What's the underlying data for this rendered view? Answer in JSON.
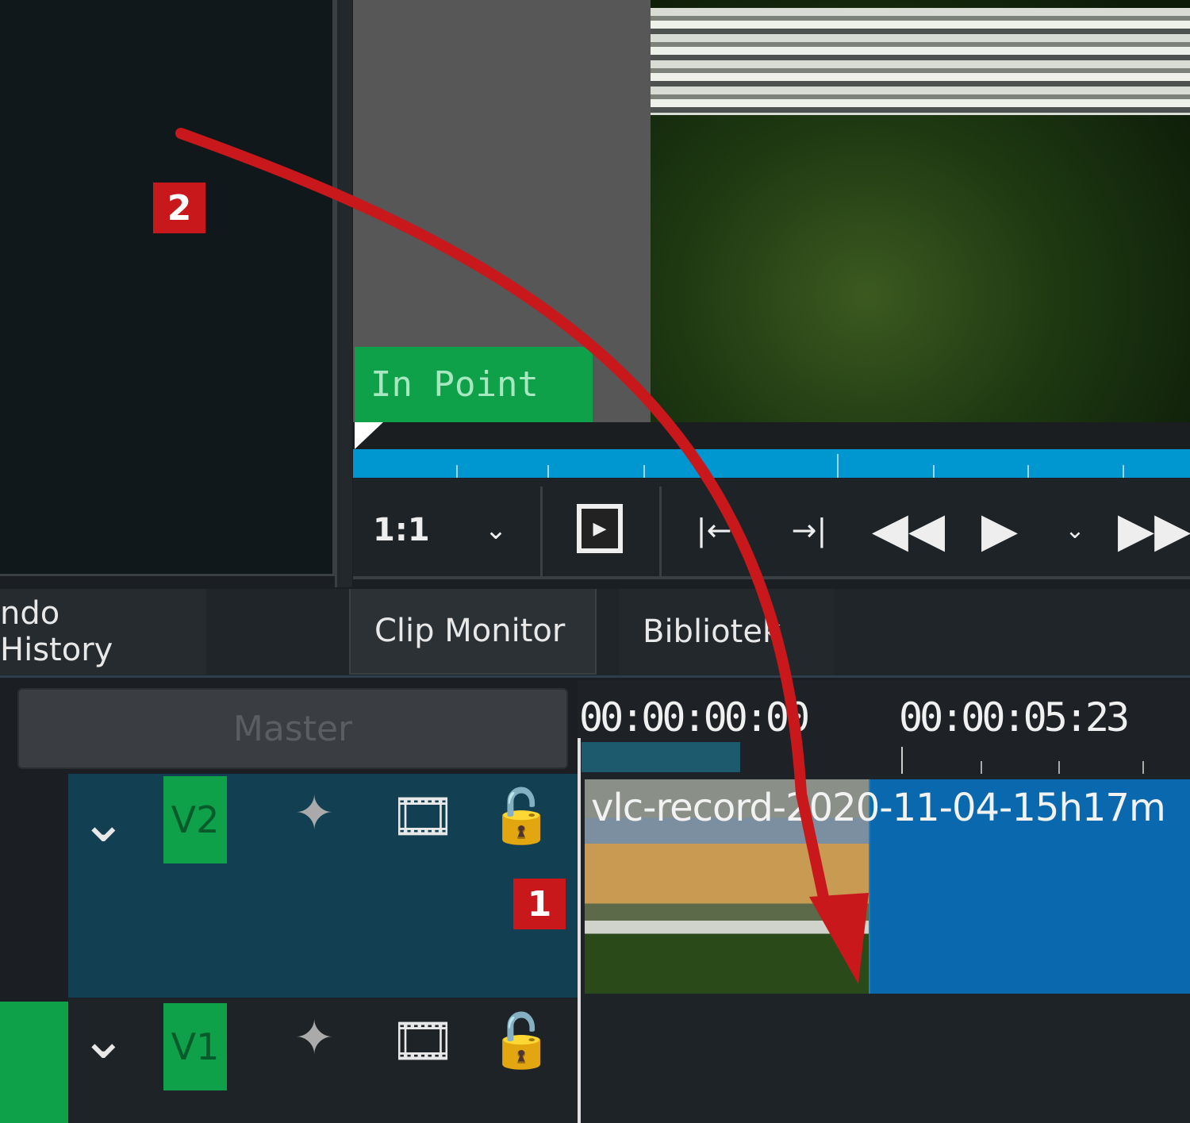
{
  "monitor": {
    "in_point_label": "In Point",
    "zoom_label": "1:1"
  },
  "tabs": [
    {
      "label": "ndo History"
    },
    {
      "label": "Clip Monitor"
    },
    {
      "label": "Bibliotek"
    }
  ],
  "timeline": {
    "master_label": "Master",
    "timecodes": [
      "00:00:00:00",
      "00:00:05:23"
    ],
    "tracks": [
      {
        "name": "V2"
      },
      {
        "name": "V1"
      }
    ],
    "clip_title": "vlc-record-2020-11-04-15h17m"
  },
  "annotations": {
    "badge_1": "1",
    "badge_2": "2"
  },
  "colors": {
    "accent_blue": "#0096d0",
    "track_green": "#0fa04a",
    "annotation_red": "#c8181b"
  }
}
